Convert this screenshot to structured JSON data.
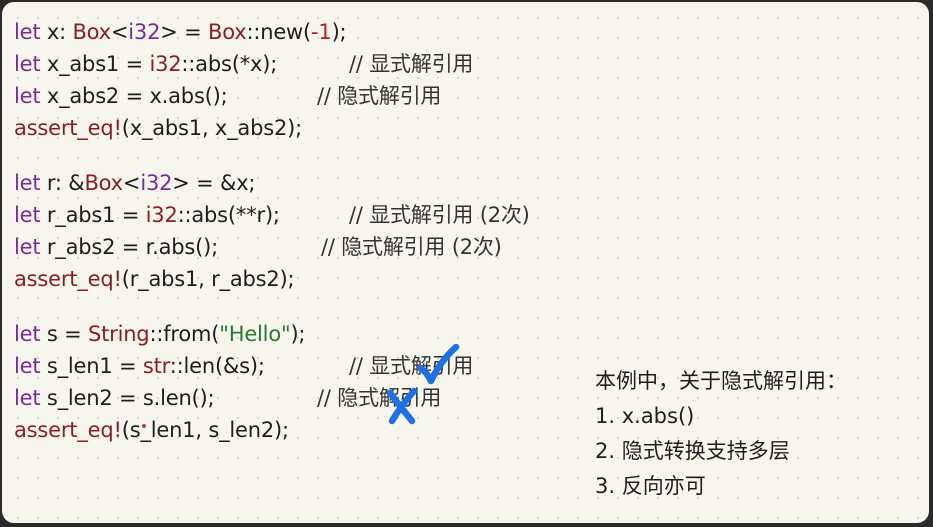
{
  "code": {
    "l1": {
      "kw": "let",
      "a": " x: ",
      "ty1": "Box",
      "b": "<",
      "kw2": "i32",
      "c": "> = ",
      "ty2": "Box",
      "d": "::new(",
      "num": "-1",
      "e": ");"
    },
    "l2": {
      "kw": "let",
      "a": " x_abs1 = ",
      "kw2": "i32",
      "b": "::abs(*x);",
      "comment": "// 显式解引用"
    },
    "l3": {
      "kw": "let",
      "a": " x_abs2 = x.abs();",
      "comment": "// 隐式解引用"
    },
    "l4": {
      "mac": "assert_eq!",
      "a": "(x_abs1, x_abs2);"
    },
    "l5": {
      "kw": "let",
      "a": " r: &",
      "ty1": "Box",
      "b": "<",
      "kw2": "i32",
      "c": "> = &x;"
    },
    "l6": {
      "kw": "let",
      "a": " r_abs1 = ",
      "kw2": "i32",
      "b": "::abs(**r);",
      "comment": "// 显式解引用 (2次)"
    },
    "l7": {
      "kw": "let",
      "a": " r_abs2 = r.abs();",
      "comment": "// 隐式解引用 (2次)"
    },
    "l8": {
      "mac": "assert_eq!",
      "a": "(r_abs1, r_abs2);"
    },
    "l9": {
      "kw": "let",
      "a": " s = ",
      "ty1": "String",
      "b": "::from(",
      "str": "\"Hello\"",
      "c": ");"
    },
    "l10": {
      "kw": "let",
      "a": " s_len1 = ",
      "ty1": "str",
      "b": "::len(&s);",
      "comment": "// 显式解引用"
    },
    "l11": {
      "kw": "let",
      "a": " s_len2 = s.len();",
      "comment": "// 隐式解引用"
    },
    "l12": {
      "mac": "assert_eq!",
      "a": "(s_len1, s_len2);"
    }
  },
  "note": {
    "title": "本例中，关于隐式解引用：",
    "item1": "1. x.abs()",
    "item2": "2. 隐式转换支持多层",
    "item3": "3. 反向亦可"
  },
  "annotations": {
    "ink_color": "#1f6fe5",
    "marks": [
      "check-mark",
      "cross-mark"
    ]
  },
  "colors": {
    "background": "#f7f6ee",
    "keyword": "#7a2a9a",
    "type": "#8b1e1e",
    "number": "#b52020",
    "string": "#2b7a2b"
  }
}
